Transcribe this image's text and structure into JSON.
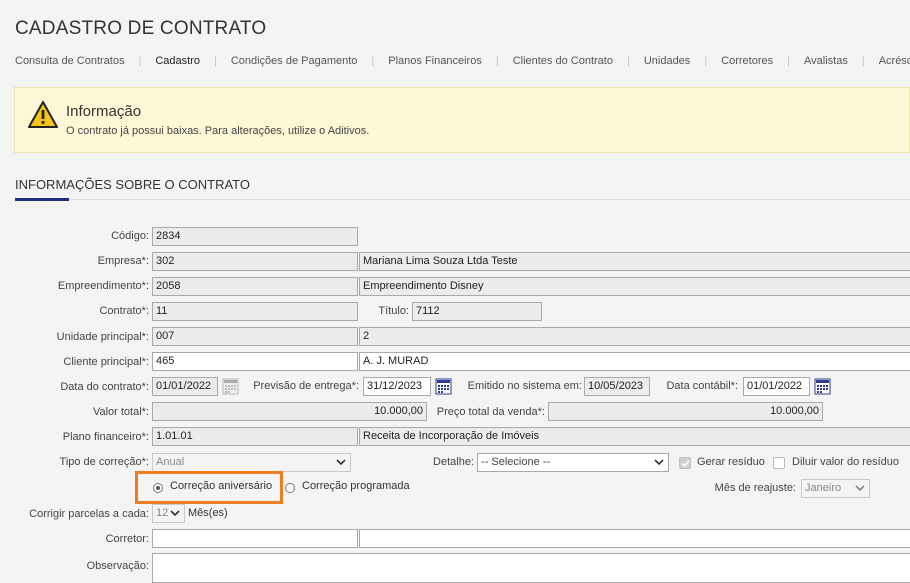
{
  "page": {
    "title": "CADASTRO DE CONTRATO"
  },
  "tabs": [
    {
      "label": "Consulta de Contratos"
    },
    {
      "label": "Cadastro",
      "active": true
    },
    {
      "label": "Condições de Pagamento"
    },
    {
      "label": "Planos Financeiros"
    },
    {
      "label": "Clientes do Contrato"
    },
    {
      "label": "Unidades"
    },
    {
      "label": "Corretores"
    },
    {
      "label": "Avalistas"
    },
    {
      "label": "Acréscimos"
    }
  ],
  "info": {
    "title": "Informação",
    "text": "O contrato já possui baixas. Para alterações, utilize o Aditivos.",
    "icon": "warning-icon"
  },
  "section": {
    "title": "INFORMAÇÕES SOBRE O CONTRATO",
    "accent_color": "#1f2d7a"
  },
  "form": {
    "codigo": {
      "label": "Código:",
      "value": "2834"
    },
    "empresa": {
      "label": "Empresa*:",
      "code": "302",
      "name": "Mariana  Lima Souza Ltda Teste"
    },
    "empreendimento": {
      "label": "Empreendimento*:",
      "code": "2058",
      "name": "Empreendimento Disney"
    },
    "contrato": {
      "label": "Contrato*:",
      "value": "11"
    },
    "titulo": {
      "label": "Título:",
      "value": "7112"
    },
    "unidade": {
      "label": "Unidade principal*:",
      "code": "007",
      "name": "2"
    },
    "cliente": {
      "label": "Cliente principal*:",
      "code": "465",
      "name": "A. J. MURAD"
    },
    "data_contrato": {
      "label": "Data do contrato*:",
      "value": "01/01/2022"
    },
    "previsao": {
      "label": "Previsão de entrega*:",
      "value": "31/12/2023"
    },
    "emitido": {
      "label": "Emitido no sistema em:",
      "value": "10/05/2023"
    },
    "data_contabil": {
      "label": "Data contábil*:",
      "value": "01/01/2022"
    },
    "valor_total": {
      "label": "Valor total*:",
      "value": "10.000,00"
    },
    "preco_venda": {
      "label": "Preço total da venda*:",
      "value": "10.000,00"
    },
    "plano": {
      "label": "Plano financeiro*:",
      "code": "1.01.01",
      "name": "Receita de Incorporação de Imóveis"
    },
    "tipo_correcao": {
      "label": "Tipo de correção*:",
      "value": "Anual"
    },
    "detalhe": {
      "label": "Detalhe:",
      "value": "-- Selecione --"
    },
    "gerar_residuo": {
      "label": "Gerar resíduo",
      "checked": true
    },
    "diluir_residuo": {
      "label": "Diluir valor do resíduo",
      "checked": false
    },
    "correcao_aniversario": {
      "label": "Correção aniversário",
      "selected": true
    },
    "correcao_programada": {
      "label": "Correção programada",
      "selected": false
    },
    "mes_reajuste": {
      "label": "Mês de reajuste:",
      "value": "Janeiro"
    },
    "corrigir_parcelas": {
      "label": "Corrigir parcelas a cada:",
      "value": "12",
      "unit": "Mês(es)"
    },
    "corretor": {
      "label": "Corretor:",
      "value": ""
    },
    "observacao": {
      "label": "Observação:"
    }
  },
  "highlight_color": "#f07c22"
}
